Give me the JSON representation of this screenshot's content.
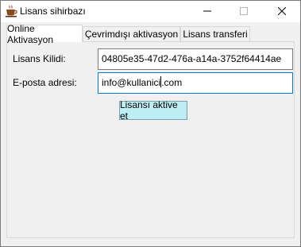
{
  "window": {
    "title": "Lisans sihirbazı",
    "icon": "coffee-cup-icon"
  },
  "titlebar_buttons": {
    "minimize_icon": "minimize-icon",
    "maximize_icon": "maximize-icon",
    "close_icon": "close-icon"
  },
  "tabs": [
    {
      "label": "Online Aktivasyon",
      "selected": true
    },
    {
      "label": "Çevrimdışı aktivasyon",
      "selected": false
    },
    {
      "label": "Lisans transferi",
      "selected": false
    }
  ],
  "form": {
    "license_key_label": "Lisans Kilidi:",
    "license_key_value": "04805e35-47d2-476a-a14a-3752f64414ae",
    "email_label": "E-posta adresi:",
    "email_value_before_caret": "info@kullanici",
    "email_value_after_caret": ".com",
    "activate_button": "Lisansı aktive et"
  },
  "colors": {
    "button_bg": "#bdeef3",
    "focus_border": "#0078d7",
    "window_bg": "#f0f0f0"
  }
}
